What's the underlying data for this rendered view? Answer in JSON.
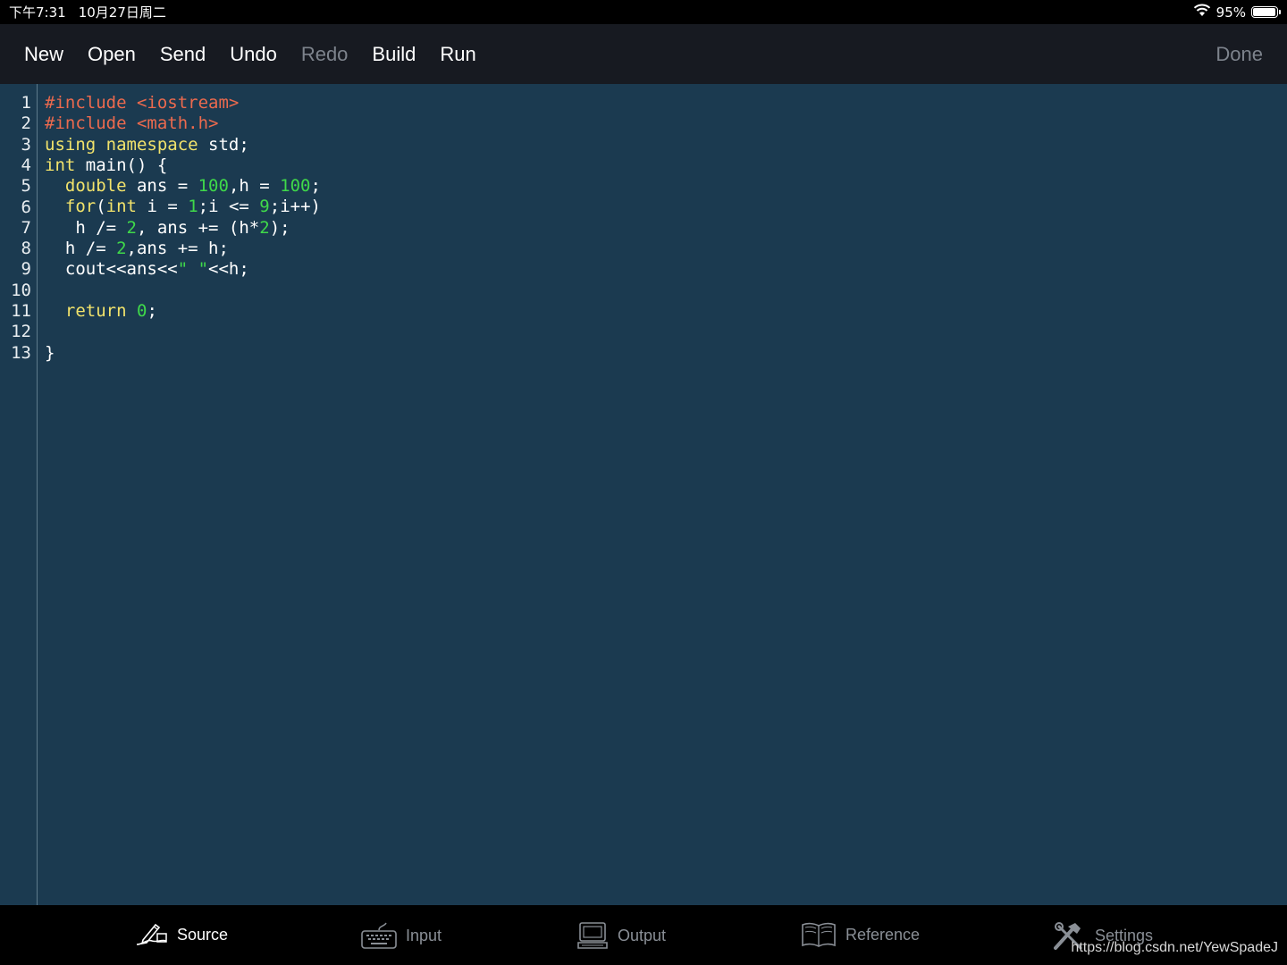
{
  "status": {
    "time": "下午7:31",
    "date": "10月27日周二",
    "battery_percent": "95%",
    "battery_level": 0.95
  },
  "toolbar": {
    "new_label": "New",
    "open_label": "Open",
    "send_label": "Send",
    "undo_label": "Undo",
    "redo_label": "Redo",
    "build_label": "Build",
    "run_label": "Run",
    "done_label": "Done"
  },
  "editor": {
    "line_numbers": [
      "1",
      "2",
      "3",
      "4",
      "5",
      "6",
      "7",
      "8",
      "9",
      "10",
      "11",
      "12",
      "13"
    ],
    "lines": [
      [
        {
          "t": "#include <iostream>",
          "c": "pp"
        }
      ],
      [
        {
          "t": "#include <math.h>",
          "c": "pp"
        }
      ],
      [
        {
          "t": "using namespace",
          "c": "kw"
        },
        {
          "t": " std;",
          "c": "pl"
        }
      ],
      [
        {
          "t": "int",
          "c": "kw"
        },
        {
          "t": " main() {",
          "c": "pl"
        }
      ],
      [
        {
          "t": "  ",
          "c": "pl"
        },
        {
          "t": "double",
          "c": "kw"
        },
        {
          "t": " ans = ",
          "c": "pl"
        },
        {
          "t": "100",
          "c": "num"
        },
        {
          "t": ",h = ",
          "c": "pl"
        },
        {
          "t": "100",
          "c": "num"
        },
        {
          "t": ";",
          "c": "pl"
        }
      ],
      [
        {
          "t": "  ",
          "c": "pl"
        },
        {
          "t": "for",
          "c": "kw"
        },
        {
          "t": "(",
          "c": "pl"
        },
        {
          "t": "int",
          "c": "kw"
        },
        {
          "t": " i = ",
          "c": "pl"
        },
        {
          "t": "1",
          "c": "num"
        },
        {
          "t": ";i <= ",
          "c": "pl"
        },
        {
          "t": "9",
          "c": "num"
        },
        {
          "t": ";i++)",
          "c": "pl"
        }
      ],
      [
        {
          "t": "   h /= ",
          "c": "pl"
        },
        {
          "t": "2",
          "c": "num"
        },
        {
          "t": ", ans += (h*",
          "c": "pl"
        },
        {
          "t": "2",
          "c": "num"
        },
        {
          "t": ");",
          "c": "pl"
        }
      ],
      [
        {
          "t": "  h /= ",
          "c": "pl"
        },
        {
          "t": "2",
          "c": "num"
        },
        {
          "t": ",ans += h;",
          "c": "pl"
        }
      ],
      [
        {
          "t": "  cout<<ans<<",
          "c": "pl"
        },
        {
          "t": "\" \"",
          "c": "str"
        },
        {
          "t": "<<h;",
          "c": "pl"
        }
      ],
      [],
      [
        {
          "t": "  ",
          "c": "pl"
        },
        {
          "t": "return",
          "c": "kw"
        },
        {
          "t": " ",
          "c": "pl"
        },
        {
          "t": "0",
          "c": "num"
        },
        {
          "t": ";",
          "c": "pl"
        }
      ],
      [],
      [
        {
          "t": "}",
          "c": "pl"
        }
      ]
    ]
  },
  "tabs": {
    "source": "Source",
    "input": "Input",
    "output": "Output",
    "reference": "Reference",
    "settings": "Settings"
  },
  "watermark": "https://blog.csdn.net/YewSpadeJ",
  "colors": {
    "editor_bg": "#1b3a50",
    "keyword": "#f2e36b",
    "preprocessor": "#ec6a4e",
    "number": "#3fd94a",
    "toolbar_bg": "#171a21"
  }
}
